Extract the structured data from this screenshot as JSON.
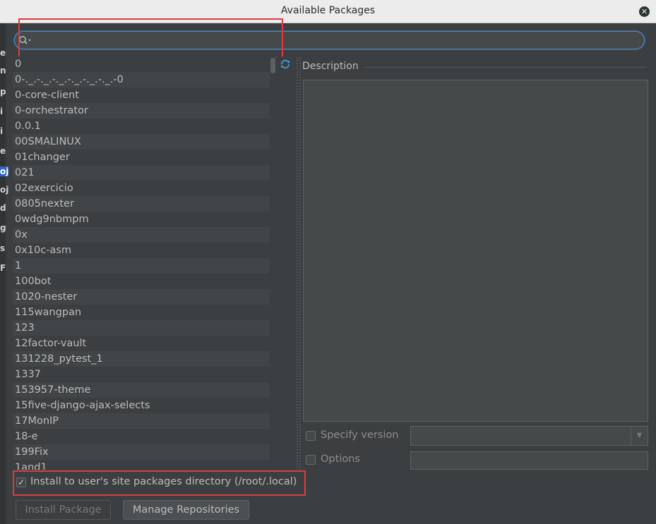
{
  "window": {
    "title": "Available Packages",
    "close_glyph": "✕"
  },
  "left_strip_letters": [
    "e",
    "n",
    "p",
    "i",
    "i",
    "e",
    "oj",
    "oj",
    "d",
    "g",
    "s",
    "F"
  ],
  "search": {
    "value": "",
    "placeholder": ""
  },
  "packages": [
    "0",
    "0-._.-._.-._.-._.-._.-._.-0",
    "0-core-client",
    "0-orchestrator",
    "0.0.1",
    "00SMALINUX",
    "01changer",
    "021",
    "02exercicio",
    "0805nexter",
    "0wdg9nbmpm",
    "0x",
    "0x10c-asm",
    "1",
    "100bot",
    "1020-nester",
    "115wangpan",
    "123",
    "12factor-vault",
    "131228_pytest_1",
    "1337",
    "153957-theme",
    "15five-django-ajax-selects",
    "17MonIP",
    "18-e",
    "199Fix",
    "1and1"
  ],
  "description": {
    "label": "Description",
    "text": ""
  },
  "specify_version": {
    "label": "Specify version",
    "checked": false,
    "selected": ""
  },
  "options": {
    "label": "Options",
    "checked": false,
    "value": ""
  },
  "install_to_user": {
    "label": "Install to user's site packages directory (/root/.local)",
    "checked": true,
    "check_glyph": "✓"
  },
  "buttons": {
    "install": "Install Package",
    "manage": "Manage Repositories"
  },
  "icons": {
    "search": "search-icon",
    "refresh": "refresh-icon",
    "close": "close-icon",
    "dropdown": "chevron-down-icon"
  },
  "colors": {
    "accent": "#4a88c7",
    "highlight": "#e5383b",
    "background": "#3c3f41"
  }
}
